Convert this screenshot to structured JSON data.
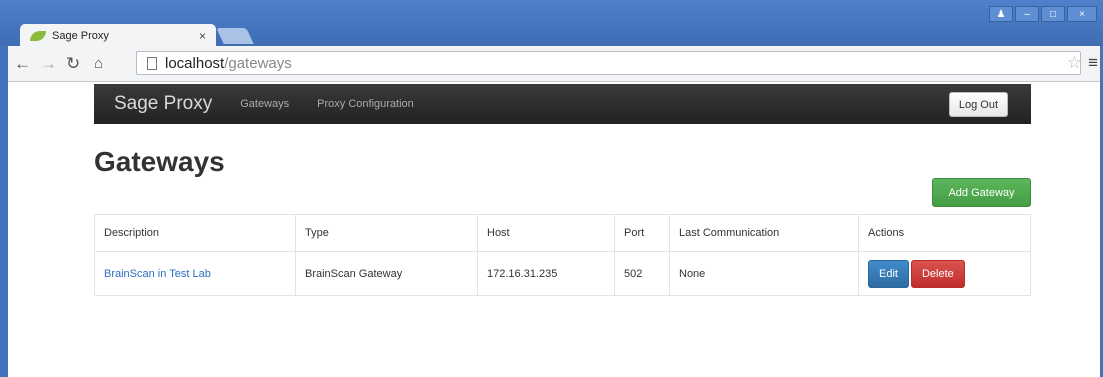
{
  "browser": {
    "tab_title": "Sage Proxy",
    "tab_close": "×",
    "url_host": "localhost",
    "url_path": "/gateways"
  },
  "navbar": {
    "brand": "Sage Proxy",
    "links": [
      "Gateways",
      "Proxy Configuration"
    ],
    "logout_label": "Log Out"
  },
  "page": {
    "title": "Gateways",
    "add_label": "Add Gateway"
  },
  "table": {
    "headers": [
      "Description",
      "Type",
      "Host",
      "Port",
      "Last Communication",
      "Actions"
    ],
    "rows": [
      {
        "description": "BrainScan in Test Lab",
        "type": "BrainScan Gateway",
        "host": "172.16.31.235",
        "port": "502",
        "last_communication": "None",
        "edit_label": "Edit",
        "delete_label": "Delete"
      }
    ]
  },
  "icons": {
    "back": "back-arrow-icon",
    "forward": "forward-arrow-icon",
    "reload": "reload-icon",
    "home": "home-icon",
    "page": "page-icon",
    "bookmark": "star-icon",
    "menu": "menu-icon"
  },
  "colors": {
    "link": "#2a6fc2",
    "add_button": "#5cb85c",
    "edit_button": "#428bca",
    "delete_button": "#d9534f",
    "navbar": "#222222"
  }
}
